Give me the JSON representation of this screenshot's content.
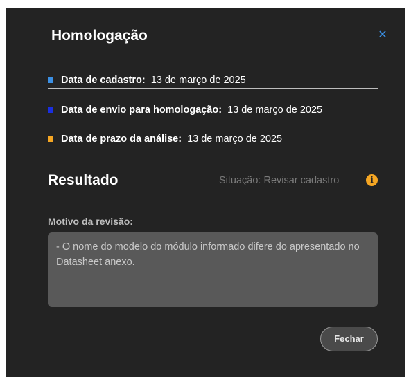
{
  "modal": {
    "title": "Homologação",
    "close_icon": "close-icon",
    "close_glyph": "✕"
  },
  "dates": [
    {
      "label": "Data de cadastro:",
      "value": "13 de março de 2025",
      "color": "#3b8fe3"
    },
    {
      "label": "Data de envio para homologação:",
      "value": "13 de março de 2025",
      "color": "#1a2fe0"
    },
    {
      "label": "Data de prazo da análise:",
      "value": "13 de março de 2025",
      "color": "#f5a623"
    }
  ],
  "result": {
    "title": "Resultado",
    "status": "Situação: Revisar cadastro",
    "info_icon": "info-icon",
    "info_glyph": "i",
    "info_color": "#f5a623"
  },
  "review": {
    "label": "Motivo da revisão:",
    "text": "- O nome do modelo do módulo informado difere do apresentado no Datasheet anexo."
  },
  "actions": {
    "close_label": "Fechar"
  }
}
